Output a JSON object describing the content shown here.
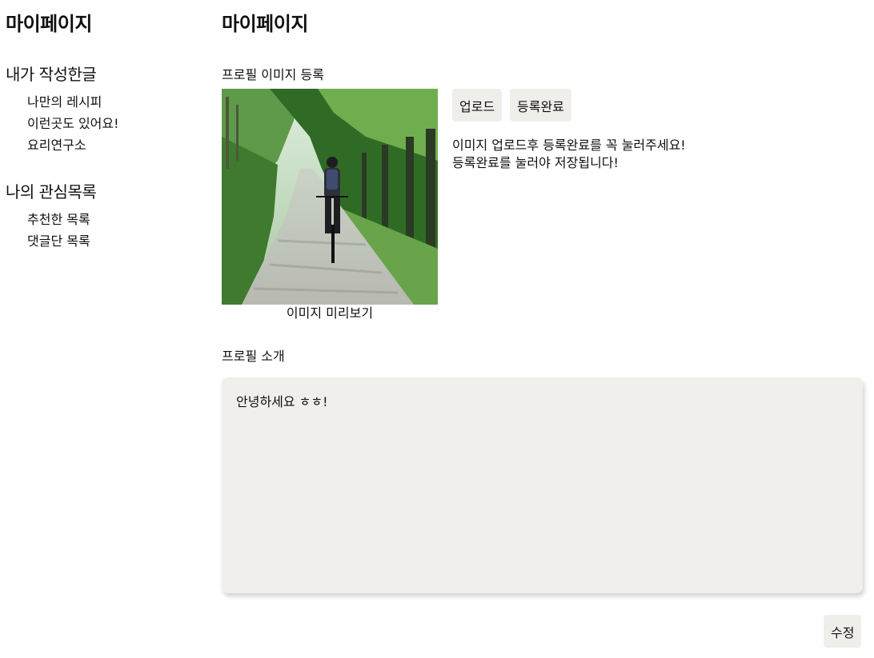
{
  "sidebar": {
    "title": "마이페이지",
    "sections": [
      {
        "heading": "내가 작성한글",
        "items": [
          "나만의 레시피",
          "이런곳도 있어요!",
          "요리연구소"
        ]
      },
      {
        "heading": "나의 관심목록",
        "items": [
          "추천한 목록",
          "댓글단 목록"
        ]
      }
    ]
  },
  "main": {
    "title": "마이페이지",
    "profile_image": {
      "label": "프로필 이미지 등록",
      "preview_caption": "이미지 미리보기",
      "upload_label": "업로드",
      "register_label": "등록완료",
      "notice_lines": [
        "이미지 업로드후 등록완료를 꼭 눌러주세요!",
        "등록완료를 눌러야 저장됩니다!"
      ]
    },
    "profile_intro": {
      "label": "프로필 소개",
      "text": "안녕하세요 ㅎㅎ!",
      "edit_label": "수정"
    }
  },
  "colors": {
    "button_bg": "#efeeea",
    "textarea_bg": "#f0efeb"
  }
}
